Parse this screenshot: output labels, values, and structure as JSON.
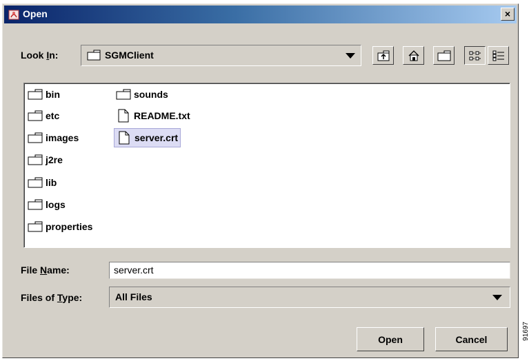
{
  "window": {
    "title": "Open",
    "close_label": "×"
  },
  "look_in": {
    "label_pre": "Look ",
    "label_mnemonic": "I",
    "label_post": "n:",
    "value": "SGMClient"
  },
  "toolbar": [
    {
      "name": "up-one-level-button",
      "icon": "folder-up-icon"
    },
    {
      "name": "home-button",
      "icon": "home-icon"
    },
    {
      "name": "new-folder-button",
      "icon": "new-folder-icon"
    },
    {
      "name": "list-view-button",
      "icon": "list-view-icon"
    },
    {
      "name": "details-view-button",
      "icon": "details-view-icon"
    }
  ],
  "files": [
    {
      "name": "bin",
      "type": "folder"
    },
    {
      "name": "etc",
      "type": "folder"
    },
    {
      "name": "images",
      "type": "folder"
    },
    {
      "name": "j2re",
      "type": "folder"
    },
    {
      "name": "lib",
      "type": "folder"
    },
    {
      "name": "logs",
      "type": "folder"
    },
    {
      "name": "properties",
      "type": "folder"
    },
    {
      "name": "sounds",
      "type": "folder"
    },
    {
      "name": "README.txt",
      "type": "file"
    },
    {
      "name": "server.crt",
      "type": "file",
      "selected": true
    }
  ],
  "file_name": {
    "label_pre": "File ",
    "label_mnemonic": "N",
    "label_post": "ame:",
    "value": "server.crt"
  },
  "files_of_type": {
    "label_pre": "Files of ",
    "label_mnemonic": "T",
    "label_post": "ype:",
    "value": "All Files"
  },
  "buttons": {
    "open": "Open",
    "cancel": "Cancel"
  },
  "side_mark": "91697",
  "colors": {
    "selection_bg": "#dcdcf4",
    "title_gradient_start": "#0a246a",
    "title_gradient_end": "#a6caf0",
    "dialog_bg": "#d4d0c8"
  }
}
